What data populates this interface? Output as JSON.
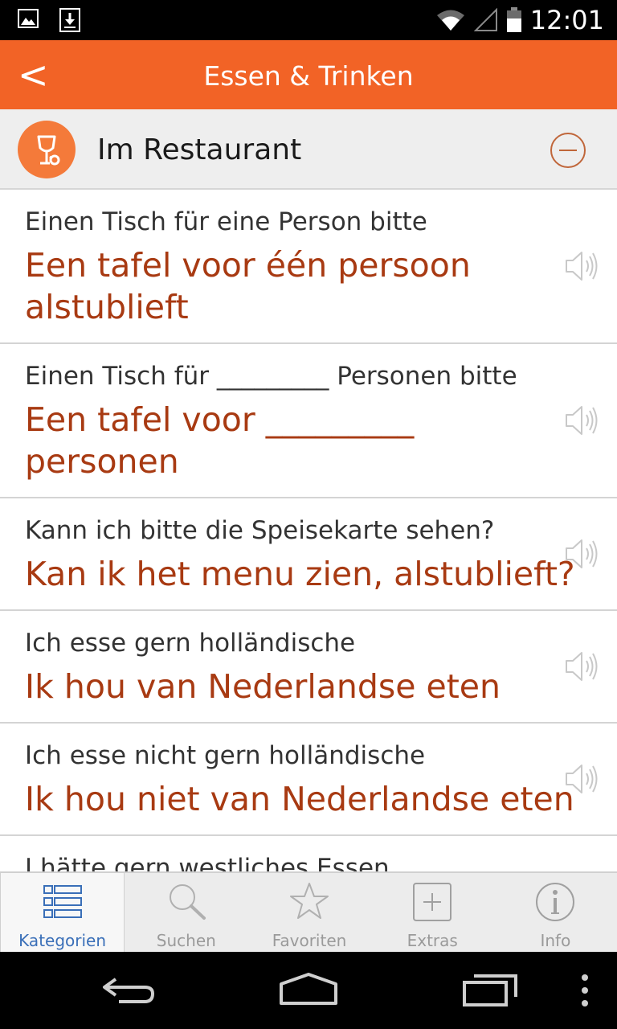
{
  "status_bar": {
    "time": "12:01"
  },
  "action_bar": {
    "back_label": "<",
    "title": "Essen & Trinken"
  },
  "category": {
    "title": "Im Restaurant",
    "icon": "wine-glass-icon",
    "expanded": true
  },
  "phrases": [
    {
      "source": "Einen Tisch für eine Person bitte",
      "target": "Een tafel voor één persoon alstublieft"
    },
    {
      "source": "Einen Tisch für _________ Personen bitte",
      "target": "Een tafel voor _________ personen"
    },
    {
      "source": "Kann ich bitte die Speisekarte sehen?",
      "target": "Kan ik het menu zien, alstublieft?"
    },
    {
      "source": "Ich esse gern holländische",
      "target": "Ik hou van Nederlandse eten"
    },
    {
      "source": "Ich esse nicht gern holländische",
      "target": "Ik hou niet van Nederlandse eten"
    },
    {
      "source": "I hätte gern westliches Essen",
      "target": ""
    }
  ],
  "tabs": [
    {
      "label": "Kategorien",
      "icon": "list-icon",
      "active": true
    },
    {
      "label": "Suchen",
      "icon": "search-icon",
      "active": false
    },
    {
      "label": "Favoriten",
      "icon": "star-icon",
      "active": false
    },
    {
      "label": "Extras",
      "icon": "plus-box-icon",
      "active": false
    },
    {
      "label": "Info",
      "icon": "info-icon",
      "active": false
    }
  ],
  "colors": {
    "accent": "#f26326",
    "translation": "#a83a12",
    "active_tab": "#3a6fb8"
  }
}
